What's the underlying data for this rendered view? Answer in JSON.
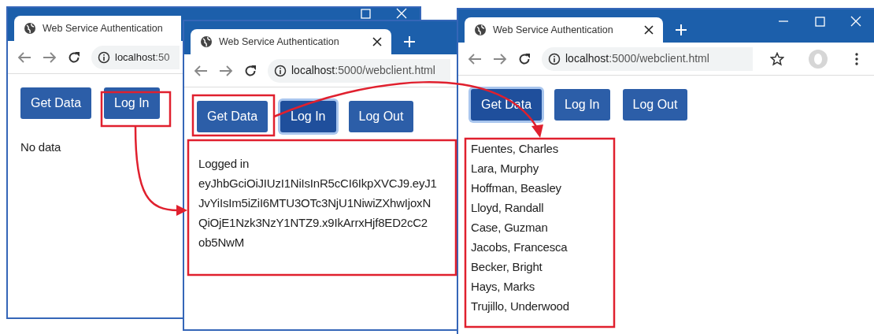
{
  "windows": [
    {
      "tab": {
        "title": "Web Service Authentication"
      },
      "address": {
        "host": "localhost",
        "path": ":50"
      },
      "buttons": [
        {
          "label": "Get Data",
          "focused": false
        },
        {
          "label": "Log In",
          "focused": false
        }
      ],
      "lines": [
        "No data"
      ]
    },
    {
      "tab": {
        "title": "Web Service Authentication"
      },
      "address": {
        "host": "localhost",
        "path": ":5000/webclient.html"
      },
      "buttons": [
        {
          "label": "Get Data",
          "focused": false
        },
        {
          "label": "Log In",
          "focused": true
        },
        {
          "label": "Log Out",
          "focused": false
        }
      ],
      "lines": [
        "Logged in",
        "eyJhbGciOiJIUzI1NiIsInR5cCI6IkpXVCJ9.eyJ1",
        "JvYiIsIm5iZiI6MTU3OTc3NjU1NiwiZXhwIjoxN",
        "QiOjE1Nzk3NzY1NTZ9.x9IkArrxHjf8ED2cC2",
        "ob5NwM"
      ]
    },
    {
      "tab": {
        "title": "Web Service Authentication"
      },
      "address": {
        "host": "localhost",
        "path": ":5000/webclient.html"
      },
      "buttons": [
        {
          "label": "Get Data",
          "focused": true
        },
        {
          "label": "Log In",
          "focused": false
        },
        {
          "label": "Log Out",
          "focused": false
        }
      ],
      "lines": [
        "Fuentes, Charles",
        "Lara, Murphy",
        "Hoffman, Beasley",
        "Lloyd, Randall",
        "Case, Guzman",
        "Jacobs, Francesca",
        "Becker, Bright",
        "Hays, Marks",
        "Trujillo, Underwood"
      ]
    }
  ]
}
